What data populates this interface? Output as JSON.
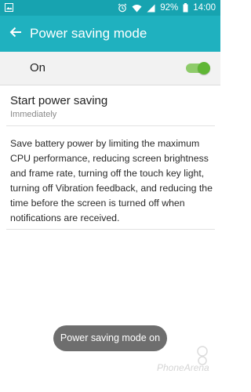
{
  "status_bar": {
    "battery_percent": "92%",
    "time": "14:00",
    "icons": [
      "gallery-icon",
      "alarm-icon",
      "wifi-icon",
      "signal-icon",
      "battery-icon"
    ]
  },
  "app_bar": {
    "title": "Power saving mode",
    "back_icon": "back-arrow-icon"
  },
  "on_row": {
    "label": "On",
    "toggle_state": true,
    "accent_color": "#5fb635"
  },
  "start_power_saving": {
    "title": "Start power saving",
    "subtitle": "Immediately"
  },
  "description": "Save battery power by limiting the maximum CPU performance, reducing screen brightness and frame rate, turning off the touch key light, turning off Vibration feedback, and reducing the time before the screen is turned off when notifications are received.",
  "toast": {
    "message": "Power saving mode on"
  },
  "watermark": {
    "text": "PhoneArena"
  },
  "colors": {
    "status_bar": "#17a3b0",
    "app_bar": "#1fb1bf",
    "toggle_on": "#5fb635"
  }
}
